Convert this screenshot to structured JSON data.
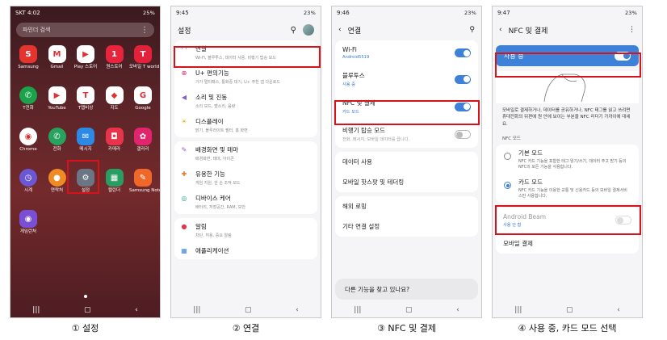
{
  "status": {
    "p1_left": "SKT 4:02",
    "p1_right": "25%",
    "p2_left": "9:45",
    "p2_right": "23%",
    "p3_left": "9:46",
    "p3_right": "23%",
    "p4_left": "9:47",
    "p4_right": "23%"
  },
  "home": {
    "search_placeholder": "파인더 검색",
    "apps": [
      {
        "label": "Samsung",
        "color": "#e3342f"
      },
      {
        "label": "Gmail",
        "color": "#ffffff"
      },
      {
        "label": "Play 스토어",
        "color": "#ffffff"
      },
      {
        "label": "원스토어",
        "color": "#e8243c"
      },
      {
        "label": "모바일 T world",
        "color": "#e4213a"
      },
      {
        "label": "T전화",
        "color": "#1aa34a"
      },
      {
        "label": "YouTube",
        "color": "#ffffff"
      },
      {
        "label": "T맵비상",
        "color": "#ffffff"
      },
      {
        "label": "지도",
        "color": "#ffffff"
      },
      {
        "label": "Google",
        "color": "#ffffff"
      },
      {
        "label": "Chrome",
        "color": "#ffffff"
      },
      {
        "label": "전화",
        "color": "#27a35f"
      },
      {
        "label": "메시지",
        "color": "#2c8ae6"
      },
      {
        "label": "카메라",
        "color": "#e8344a"
      },
      {
        "label": "갤러리",
        "color": "#e0246e"
      },
      {
        "label": "시계",
        "color": "#6b57d6"
      },
      {
        "label": "연락처",
        "color": "#f08a24"
      },
      {
        "label": "설정",
        "color": "#6a7684"
      },
      {
        "label": "캘린더",
        "color": "#2a9d63"
      },
      {
        "label": "Samsung Notes",
        "color": "#f0672a"
      },
      {
        "label": "게임런처",
        "color": "#7a4fd6"
      }
    ]
  },
  "settings": {
    "title": "설정",
    "items": [
      {
        "title": "연결",
        "sub": "Wi-Fi, 블루투스, 데이터 사용, 비행기 탑승 모드"
      },
      {
        "title": "U+ 편의기능",
        "sub": "기가 멀티패스, 통화중 대기, U+ 추천 앱 다운로드"
      },
      {
        "title": "소리 및 진동",
        "sub": "소리 모드, 벨소리, 음량"
      },
      {
        "title": "디스플레이",
        "sub": "밝기, 블루라이트 필터, 홈 화면"
      },
      {
        "title": "배경화면 및 테마",
        "sub": "배경화면, 테마, 아이콘"
      },
      {
        "title": "유용한 기능",
        "sub": "게임 지원, 한 손 조작 모드"
      },
      {
        "title": "디바이스 케어",
        "sub": "배터리, 저장공간, RAM, 보안"
      },
      {
        "title": "알림",
        "sub": "차단, 허용, 중요 알림"
      },
      {
        "title": "애플리케이션",
        "sub": ""
      }
    ]
  },
  "connections": {
    "title": "연결",
    "wifi": {
      "title": "Wi-Fi",
      "sub": "Android5519"
    },
    "bt": {
      "title": "블루투스",
      "sub": "사용 중"
    },
    "nfc": {
      "title": "NFC 및 결제",
      "sub": "카드 모드"
    },
    "airplane": {
      "title": "비행기 탑승 모드",
      "sub": "전화, 메시지, 모바일 데이터를 끕니다."
    },
    "data_usage": "데이터 사용",
    "hotspot": "모바일 핫스팟 및 테더링",
    "roaming": "해외 로밍",
    "more": "기타 연결 설정",
    "help": "다른 기능을 찾고 있나요?"
  },
  "nfc": {
    "title": "NFC 및 결제",
    "use_on": "사용 중",
    "desc": "모바일로 결제하거나, 데이터를 공유하거나, NFC 태그를 읽고 쓰려면 휴대전화의 뒤편에 원 안에 보이는 부분을 NFC 리더기 가까이에 대세요.",
    "section": "NFC 모드",
    "basic": {
      "title": "기본 모드",
      "sub": "NFC 카드 기능을 포함한 태그 읽기/쓰기, 데이터 주고 받기 등의 NFC의 모든 기능을 사용합니다."
    },
    "card": {
      "title": "카드 모드",
      "sub": "NFC 카드 기능을 이용한 교통 및 신용카드 등의 모바일 결제서비스만 사용합니다."
    },
    "beam": {
      "title": "Android Beam",
      "sub": "사용 안 함"
    },
    "mobile_pay": "모바일 결제"
  },
  "captions": [
    "① 설정",
    "② 연결",
    "③ NFC 및 결제",
    "④ 사용 중, 카드 모드 선택"
  ]
}
